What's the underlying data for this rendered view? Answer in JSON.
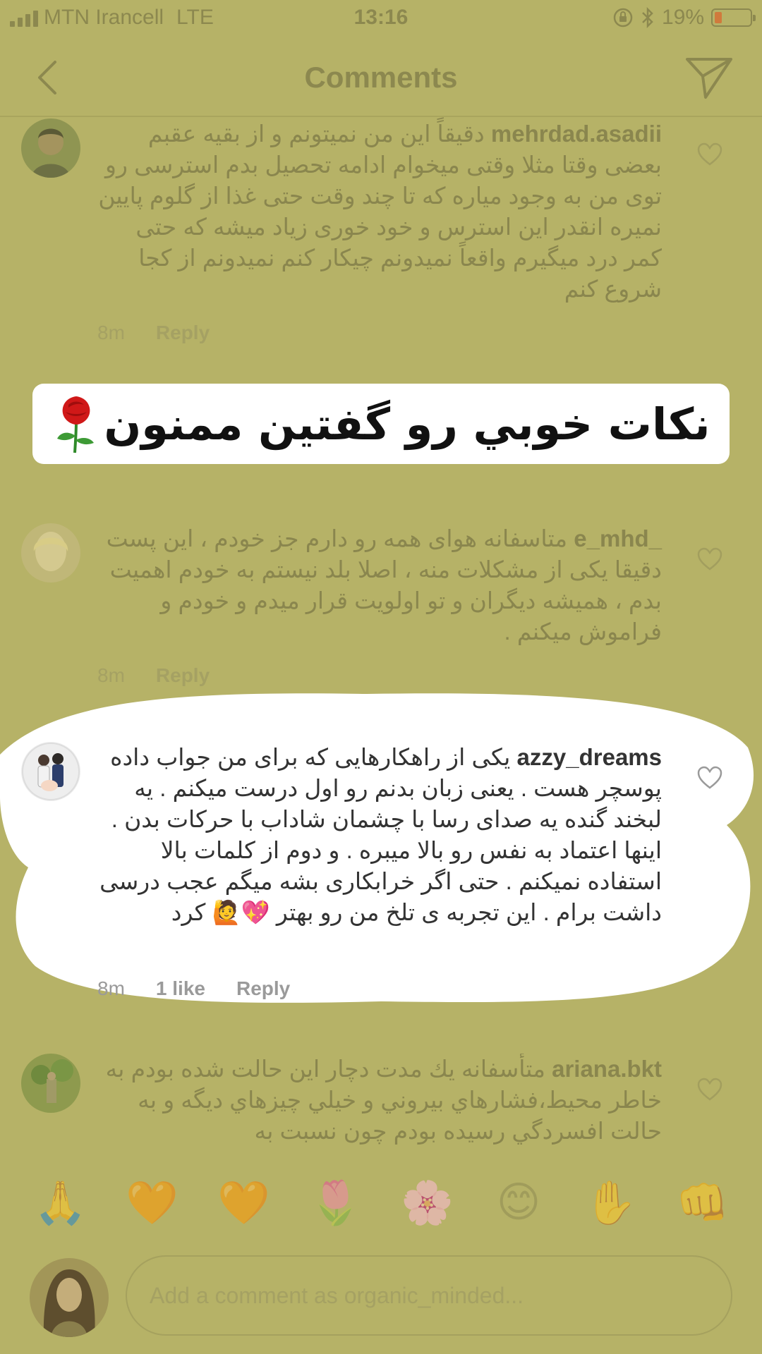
{
  "status_bar": {
    "carrier": "MTN Irancell",
    "network": "LTE",
    "time": "13:16",
    "battery": "19%",
    "battery_level": 0.19
  },
  "header": {
    "title": "Comments"
  },
  "banner": {
    "text": "نكات خوبي رو گفتين ممنون"
  },
  "comments": [
    {
      "username": "mehrdad.asadii",
      "text": "دقیقاً این من نمیتونم و از بقیه عقبم بعضی وقتا مثلا وقتی میخوام ادامه تحصیل بدم استرسی رو توی من به وجود میاره که تا چند وقت حتی غذا از گلوم پایین نمیره انقدر این استرس و خود خوری زیاد میشه که حتی کمر درد میگیرم واقعاً نمیدونم چیکار کنم نمیدونم از کجا شروع کنم",
      "time": "8m",
      "reply": "Reply"
    },
    {
      "username": "e_mhd_",
      "text": "متاسفانه هوای همه رو دارم جز خودم ، این پست دقیقا یکی از مشکلات منه ، اصلا بلد نیستم به خودم اهمیت بدم ، همیشه دیگران و تو اولویت قرار میدم و خودم و فراموش میکنم .",
      "time": "8m",
      "reply": "Reply"
    },
    {
      "username": "azzy_dreams",
      "text": "یکی از راهکارهایی که برای من جواب داده پوسچر هست . یعنی زبان بدنم رو اول درست میکنم . یه لبخند گنده یه صدای رسا با چشمان شاداب با حرکات بدن . اینها اعتماد به نفس رو بالا میبره . و دوم از کلمات بالا استفاده نمیکنم . حتی اگر خرابکاری بشه میگم عجب درسی داشت برام . این تجربه ی تلخ من رو بهتر 💖🙋 کرد",
      "time": "8m",
      "likes": "1 like",
      "reply": "Reply"
    },
    {
      "username": "ariana.bkt",
      "text": "متأسفانه يك مدت دچار اين حالت شده بودم به خاطر محيط،فشارهاي بيروني و خيلي چيزهاي ديگه و به حالت افسردگي رسيده بودم چون نسبت به",
      "time": "",
      "reply": ""
    }
  ],
  "emoji_bar": [
    "🙏",
    "🧡",
    "🧡",
    "🌷",
    "🌸",
    "😊",
    "✋",
    "👊"
  ],
  "composer": {
    "placeholder": "Add a comment as organic_minded..."
  },
  "colors": {
    "overlay": "#b6b267",
    "highlight": "#ffffff",
    "heart": "#9a9a9a"
  }
}
